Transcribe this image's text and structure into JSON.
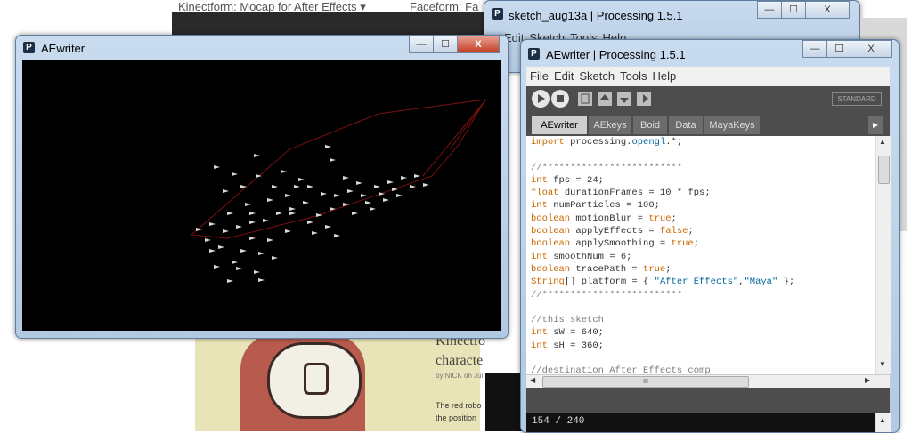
{
  "background": {
    "tabs": [
      "Kinectform: Mocap for After Effects",
      "Faceform: Fa"
    ],
    "article": {
      "title_lines": [
        "Kinectfo",
        "characte"
      ],
      "byline": "by NICK on Jul",
      "text_lines": [
        "The red robo",
        "the position"
      ]
    },
    "console_text": "154 / 240"
  },
  "aewriter_window": {
    "title": "AEwriter"
  },
  "sketch_window": {
    "title": "sketch_aug13a | Processing 1.5.1",
    "menu": [
      "Edit",
      "Sketch",
      "Tools",
      "Help"
    ]
  },
  "editor_window": {
    "title": "AEwriter | Processing 1.5.1",
    "menu": [
      "File",
      "Edit",
      "Sketch",
      "Tools",
      "Help"
    ],
    "mode_label": "STANDARD",
    "tabs": [
      "AEwriter",
      "AEkeys",
      "Boid",
      "Data",
      "MayaKeys"
    ],
    "active_tab": "AEwriter",
    "code_lines": [
      "import processing.opengl.*;",
      "",
      "//*************************",
      "int fps = 24;",
      "float durationFrames = 10 * fps;",
      "int numParticles = 100;",
      "boolean motionBlur = true;",
      "boolean applyEffects = false;",
      "boolean applySmoothing = true;",
      "int smoothNum = 6;",
      "boolean tracePath = true;",
      "String[] platform = { \"After Effects\",\"Maya\" };",
      "//*************************",
      "",
      "//this sketch",
      "int sW = 640;",
      "int sH = 360;",
      "",
      "//destination After Effects comp"
    ],
    "hscroll_mark": "III"
  },
  "window_buttons": {
    "minimize": "—",
    "maximize": "☐",
    "close": "X"
  },
  "colors": {
    "editor_dark": "#4d4d4d",
    "keyword": "#cc6600",
    "string": "#006699",
    "comment": "#7e7e7e",
    "trace_path": "#7a1010"
  }
}
